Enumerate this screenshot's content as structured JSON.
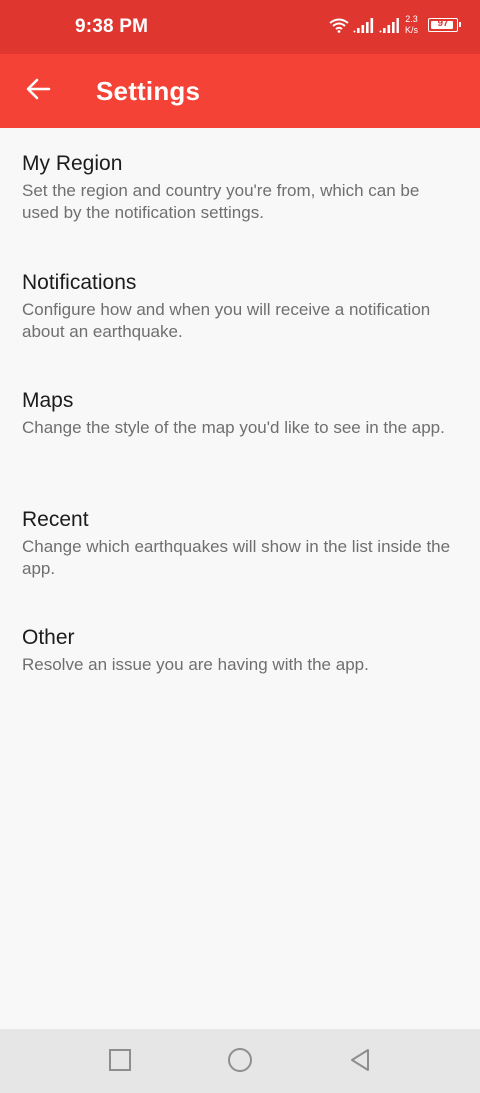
{
  "status_bar": {
    "time": "9:38 PM",
    "net_speed_value": "2.3",
    "net_speed_unit": "K/s",
    "battery_level": "97",
    "battery_fraction": 0.97
  },
  "app_bar": {
    "title": "Settings",
    "back_icon": "arrow-left-icon"
  },
  "settings": {
    "items": [
      {
        "title": "My Region",
        "description": "Set the region and country you're from, which can be used by the notification settings."
      },
      {
        "title": "Notifications",
        "description": "Configure how and when you will receive a notification about an earthquake."
      },
      {
        "title": "Maps",
        "description": "Change the style of the map you'd like to see in the app."
      },
      {
        "title": "Recent",
        "description": "Change which earthquakes will show in the list inside the app."
      },
      {
        "title": "Other",
        "description": "Resolve an issue you are having with the app."
      }
    ]
  },
  "nav_bar": {
    "buttons": [
      "recents-square-icon",
      "home-circle-icon",
      "back-triangle-icon"
    ]
  },
  "colors": {
    "status_bar": "#df3630",
    "app_bar": "#f44336",
    "background": "#f8f8f8",
    "title_text": "#1c1c1c",
    "description_text": "#6f6f6f",
    "nav_bar": "#e6e6e6"
  }
}
